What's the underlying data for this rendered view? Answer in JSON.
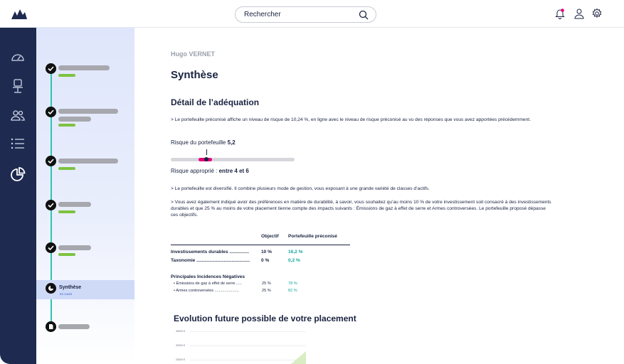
{
  "header": {
    "search_label": "Rechercher",
    "icons": [
      "logo-icon",
      "search-icon",
      "bell-icon",
      "user-icon",
      "gear-icon"
    ],
    "notification_color": "#e6007e"
  },
  "rail": {
    "icons": [
      "gauge-icon",
      "chair-icon",
      "users-icon",
      "list-icon",
      "pie-chart-icon"
    ]
  },
  "steps": {
    "active": {
      "title": "Synthèse",
      "status": "en cours"
    }
  },
  "main": {
    "client_name": "Hugo VERNET",
    "page_title": "Synthèse",
    "section_title": "Détail de l’adéquation",
    "para1": "> Le portefeuille préconisé affiche un niveau de risque de 10,24 %, en ligne avec le niveau de risque préconisé au vu des réponses que vous avez apportées précédemment.",
    "risk_label": "Risque du portefeuille",
    "risk_value": "5,2",
    "risk_marker_value": 5.2,
    "risk_range_min": 4,
    "risk_range_max": 6,
    "risk_scale_max": 18,
    "appro_label": "Risque approprié :",
    "appro_value": "entre 4 et 6",
    "para2": "> Le portefeuille est diversifié. Il combine plusieurs mode de gestion, vous exposant à une grande variété de classes d’actifs.",
    "para3": "> Vous avez également indiqué avoir des préférences en matière de durabilité, à savoir, vous souhaitez qu’au moins 10 % de votre investissement soit consacré à des investissements durables et que 25 % au moins de votre placement tienne compte des impacts suivants : Émissions de gaz à effet de serre et Armes controversées. Le portefeuille proposé dépasse ces objectifs.",
    "table": {
      "col_objectif": "Objectif",
      "col_portefeuille": "Portefeuille préconisé",
      "rows": [
        {
          "label": "Investissements durables ...............",
          "objectif": "10 %",
          "portefeuille": "16,2 %"
        },
        {
          "label": "Taxonomie .........................................",
          "objectif": "0 %",
          "portefeuille": "0,2 %"
        }
      ],
      "pin_title": "Principales Incidences Négatives",
      "pin_rows": [
        {
          "label": "•  Émissions de gaz à effet de serre .....",
          "objectif": "25 %",
          "portefeuille": "78 %"
        },
        {
          "label": "•  Armes controversées ......................",
          "objectif": "25 %",
          "portefeuille": "82 %"
        }
      ]
    },
    "evo_title": "Evolution future possible de votre placement",
    "y_ticks": [
      "35000 €",
      "30000 €",
      "25000 €"
    ]
  },
  "chart_data": {
    "type": "area",
    "title": "Evolution future possible de votre placement",
    "yticks": [
      "35000 €",
      "30000 €",
      "25000 €"
    ],
    "series": []
  }
}
